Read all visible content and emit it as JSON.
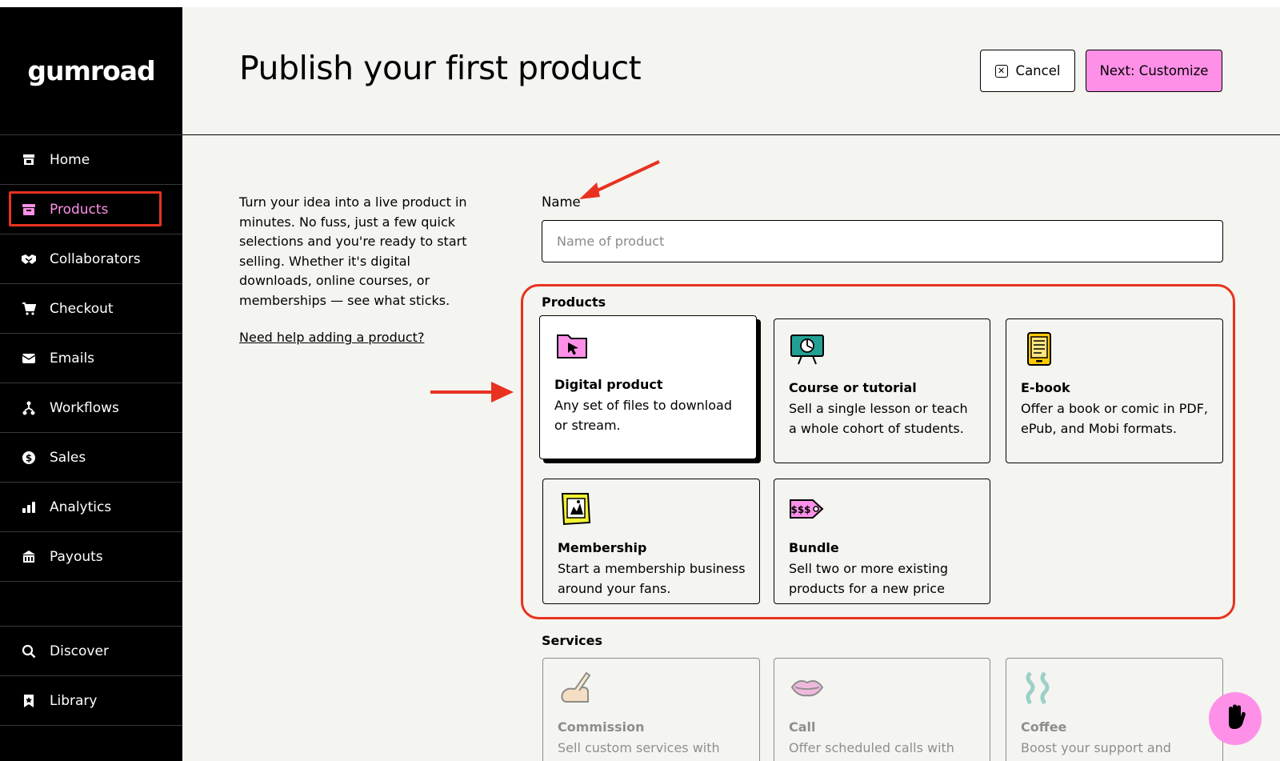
{
  "app": {
    "logo": "gumroad"
  },
  "sidebar": {
    "items": [
      {
        "label": "Home",
        "icon": "store-icon"
      },
      {
        "label": "Products",
        "icon": "archive-icon",
        "active": true
      },
      {
        "label": "Collaborators",
        "icon": "handshake-icon"
      },
      {
        "label": "Checkout",
        "icon": "cart-icon"
      },
      {
        "label": "Emails",
        "icon": "envelope-icon"
      },
      {
        "label": "Workflows",
        "icon": "workflow-icon"
      },
      {
        "label": "Sales",
        "icon": "dollar-circle-icon"
      },
      {
        "label": "Analytics",
        "icon": "bar-chart-icon"
      },
      {
        "label": "Payouts",
        "icon": "bank-icon"
      }
    ],
    "bottom_items": [
      {
        "label": "Discover",
        "icon": "search-icon"
      },
      {
        "label": "Library",
        "icon": "bookmark-icon"
      }
    ]
  },
  "header": {
    "title": "Publish your first product",
    "cancel_label": "Cancel",
    "next_label": "Next: Customize"
  },
  "intro": {
    "text": "Turn your idea into a live product in minutes. No fuss, just a few quick selections and you're ready to start selling. Whether it's digital downloads, online courses, or memberships — see what sticks.",
    "help_link": "Need help adding a product?"
  },
  "form": {
    "name_label": "Name",
    "name_placeholder": "Name of product",
    "name_value": "",
    "products_label": "Products",
    "services_label": "Services"
  },
  "products": [
    {
      "title": "Digital product",
      "desc": "Any set of files to download or stream.",
      "icon": "folder-cursor-icon",
      "selected": true
    },
    {
      "title": "Course or tutorial",
      "desc": "Sell a single lesson or teach a whole cohort of students.",
      "icon": "presentation-board-icon"
    },
    {
      "title": "E-book",
      "desc": "Offer a book or comic in PDF, ePub, and Mobi formats.",
      "icon": "ebook-icon"
    },
    {
      "title": "Membership",
      "desc": "Start a membership business around your fans.",
      "icon": "membership-card-icon"
    },
    {
      "title": "Bundle",
      "desc": "Sell two or more existing products for a new price",
      "icon": "price-tag-icon"
    }
  ],
  "services": [
    {
      "title": "Commission",
      "desc": "Sell custom services with",
      "icon": "hand-pen-icon"
    },
    {
      "title": "Call",
      "desc": "Offer scheduled calls with",
      "icon": "lips-icon"
    },
    {
      "title": "Coffee",
      "desc": "Boost your support and",
      "icon": "steam-icon"
    }
  ],
  "colors": {
    "sidebar_bg": "#000000",
    "main_bg": "#f4f4f0",
    "accent_pink": "#ff90e8",
    "annotation_red": "#e8321f"
  }
}
